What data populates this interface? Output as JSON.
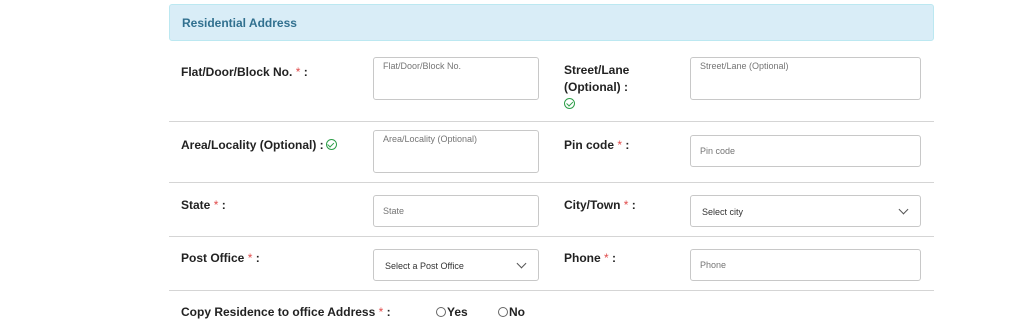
{
  "section": {
    "title": "Residential Address"
  },
  "form": {
    "required_mark": "*",
    "colon": ":",
    "flat": {
      "label": "Flat/Door/Block No.",
      "placeholder": "Flat/Door/Block No."
    },
    "street": {
      "label_line1": "Street/Lane",
      "label_line2": "(Optional) :",
      "placeholder": "Street/Lane (Optional)"
    },
    "area": {
      "label": "Area/Locality (Optional) :",
      "placeholder": "Area/Locality (Optional)"
    },
    "pincode": {
      "label": "Pin code",
      "placeholder": "Pin code"
    },
    "state": {
      "label": "State",
      "placeholder": "State"
    },
    "city": {
      "label": "City/Town",
      "selected": "Select city"
    },
    "post_office": {
      "label": "Post Office",
      "selected": "Select a Post Office"
    },
    "phone": {
      "label": "Phone",
      "placeholder": "Phone"
    },
    "copy_residence": {
      "label": "Copy Residence to office Address",
      "yes": "Yes",
      "no": "No"
    }
  },
  "icons": {
    "valid": "check-circle-icon",
    "dropdown": "chevron-down-icon",
    "radio": "radio-icon"
  },
  "colors": {
    "header_bg": "#d9edf7",
    "header_text": "#31708f",
    "required": "#e04b4b",
    "valid_icon": "#2e9e49"
  }
}
